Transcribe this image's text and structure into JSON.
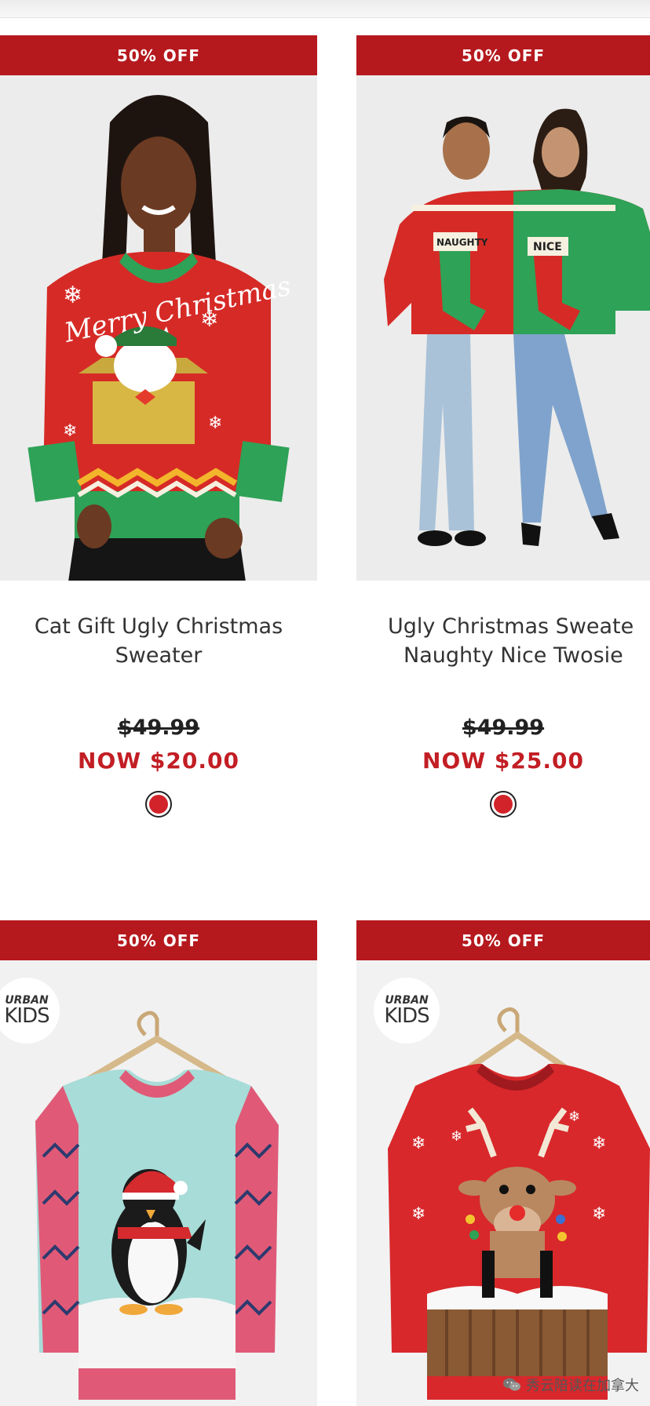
{
  "products": [
    {
      "badge": "50% OFF",
      "title_line1": "Cat Gift Ugly Christmas",
      "title_line2": "Sweater",
      "old_price": "$49.99",
      "now_price": "NOW $20.00",
      "swatch_color": "#d3232a",
      "image": "woman-red-cat-sweater"
    },
    {
      "badge": "50% OFF",
      "title_line1": "Ugly Christmas Sweate",
      "title_line2": "Naughty Nice Twosie",
      "old_price": "$49.99",
      "now_price": "NOW $25.00",
      "swatch_color": "#d3232a",
      "image": "couple-twosie-sweater",
      "sweater_text_left": "NAUGHTY",
      "sweater_text_right": "NICE"
    },
    {
      "badge": "50% OFF",
      "logo_top": "URBAN",
      "logo_bottom": "KIDS",
      "image": "kids-penguin-sweater"
    },
    {
      "badge": "50% OFF",
      "logo_top": "URBAN",
      "logo_bottom": "KIDS",
      "image": "kids-reindeer-sweater"
    }
  ],
  "watermark": {
    "icon": "wechat-icon",
    "text": "秀云陪读在加拿大"
  },
  "colors": {
    "badge": "#b5191e",
    "sale_price": "#c21e24"
  }
}
